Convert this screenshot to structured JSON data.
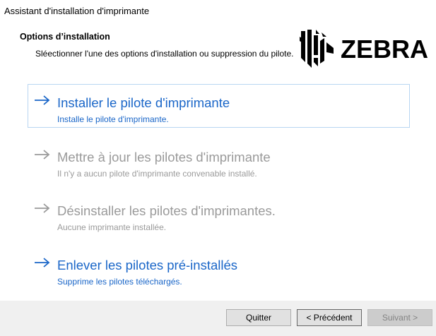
{
  "window": {
    "title": "Assistant d'installation d'imprimante"
  },
  "header": {
    "title": "Options d’installation",
    "description": "Sléectionner l'une des options d'installation ou suppression du pilote.",
    "logo_text": "ZEBRA"
  },
  "options": [
    {
      "label": "Installer le pilote d'imprimante",
      "sub": "Installe le pilote d'imprimante.",
      "state": "enabled",
      "selected": true
    },
    {
      "label": "Mettre à jour les pilotes d'imprimante",
      "sub": "Il n'y a aucun pilote d'imprimante convenable installé.",
      "state": "disabled",
      "selected": false
    },
    {
      "label": "Désinstaller les pilotes d'imprimantes.",
      "sub": "Aucune imprimante installée.",
      "state": "disabled",
      "selected": false
    },
    {
      "label": "Enlever les pilotes pré-installés",
      "sub": "Supprime les pilotes téléchargés.",
      "state": "enabled",
      "selected": false
    }
  ],
  "footer": {
    "quit_label": "Quitter",
    "back_label": "< Précédent",
    "next_label": "Suivant >"
  },
  "colors": {
    "accent": "#1a66c8",
    "disabled": "#9a9a9a",
    "selection_border": "#b8d6f2"
  }
}
